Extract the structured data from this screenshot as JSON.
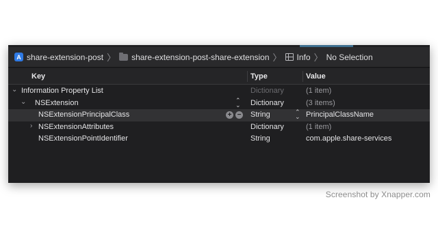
{
  "jumpbar": {
    "project": "share-extension-post",
    "folder": "share-extension-post-share-extension",
    "file": "Info",
    "selection": "No Selection"
  },
  "columns": {
    "key": "Key",
    "type": "Type",
    "value": "Value"
  },
  "rows": [
    {
      "key": "Information Property List",
      "type": "Dictionary",
      "value": "(1 item)",
      "disclosure": "expanded"
    },
    {
      "key": "NSExtension",
      "type": "Dictionary",
      "value": "(3 items)",
      "disclosure": "expanded"
    },
    {
      "key": "NSExtensionPrincipalClass",
      "type": "String",
      "value": "PrincipalClassName",
      "selected": true
    },
    {
      "key": "NSExtensionAttributes",
      "type": "Dictionary",
      "value": "(1 item)",
      "disclosure": "collapsed"
    },
    {
      "key": "NSExtensionPointIdentifier",
      "type": "String",
      "value": "com.apple.share-services"
    }
  ],
  "watermark": "Screenshot by Xnapper.com"
}
